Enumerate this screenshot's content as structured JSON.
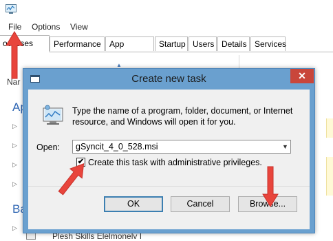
{
  "task_manager": {
    "menu": [
      "File",
      "Options",
      "View"
    ],
    "tabs": [
      "Processes",
      "Performance",
      "App history",
      "Startup",
      "Users",
      "Details",
      "Services"
    ],
    "tab_visible_labels": [
      "ocesses",
      "Performance",
      "App history",
      "Startup",
      "Users",
      "Details",
      "Services"
    ],
    "name_column_partial": "Nar",
    "group_apps_partial": "Ap",
    "group_background_partial": "Ba",
    "last_row_partial": "Plesh Skills Elelmonelv I"
  },
  "dialog": {
    "title": "Create new task",
    "close_glyph": "✕",
    "description": "Type the name of a program, folder, document, or Internet resource, and Windows will open it for you.",
    "open_label": "Open:",
    "open_value": "gSyncit_4_0_528.msi",
    "admin_checked_glyph": "✔",
    "admin_label": "Create this task with administrative privileges.",
    "ok_label": "OK",
    "cancel_label": "Cancel",
    "browse_label": "Browse..."
  },
  "colors": {
    "dialog_frame": "#6aa0cf",
    "close_button": "#c9463b",
    "annotation_arrow": "#e8453c",
    "group_header": "#2f66b3"
  }
}
